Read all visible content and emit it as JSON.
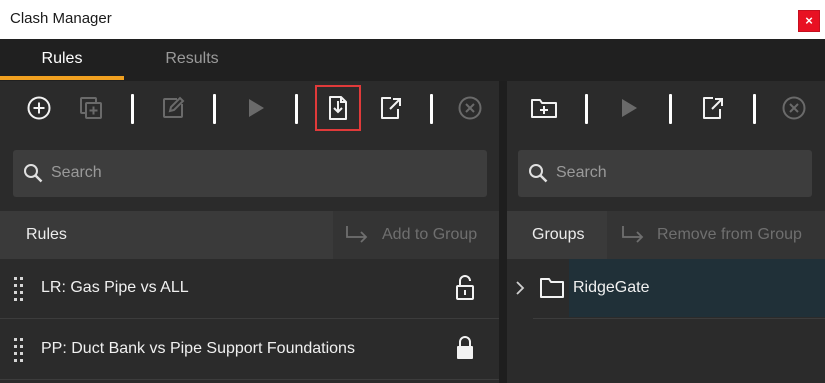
{
  "window": {
    "title": "Clash Manager",
    "close_glyph": "×"
  },
  "tabs": [
    {
      "label": "Rules",
      "active": true
    },
    {
      "label": "Results",
      "active": false
    }
  ],
  "accent_color": "#f0a020",
  "rules_panel": {
    "toolbar": [
      {
        "icon": "add-circle-icon",
        "enabled": true
      },
      {
        "icon": "copy-plus-icon",
        "enabled": false
      },
      {
        "icon": "edit-icon",
        "enabled": false
      },
      {
        "icon": "play-icon",
        "enabled": false
      },
      {
        "icon": "import-file-icon",
        "enabled": true,
        "highlighted": true
      },
      {
        "icon": "export-file-icon",
        "enabled": true
      },
      {
        "icon": "cancel-circle-icon",
        "enabled": false
      }
    ],
    "search_placeholder": "Search",
    "header_label": "Rules",
    "add_to_group_label": "Add to Group",
    "rules": [
      {
        "label": "LR: Gas Pipe vs ALL",
        "lock": "unlocked-icon"
      },
      {
        "label": "PP: Duct Bank vs Pipe Support Foundations",
        "lock": "locked-icon"
      }
    ]
  },
  "groups_panel": {
    "toolbar": [
      {
        "icon": "add-folder-icon",
        "enabled": true
      },
      {
        "icon": "play-icon",
        "enabled": false
      },
      {
        "icon": "export-file-icon",
        "enabled": true
      },
      {
        "icon": "cancel-circle-icon",
        "enabled": false
      }
    ],
    "search_placeholder": "Search",
    "header_label": "Groups",
    "remove_from_group_label": "Remove from Group",
    "groups": [
      {
        "label": "RidgeGate",
        "expanded": false
      }
    ]
  }
}
